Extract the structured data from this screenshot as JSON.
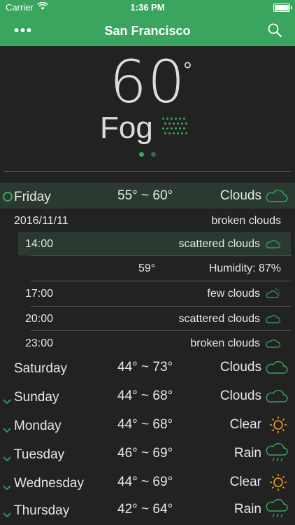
{
  "status": {
    "carrier": "Carrier",
    "time": "1:36 PM"
  },
  "nav": {
    "title": "San Francisco"
  },
  "current": {
    "temp": "60",
    "degree": "°",
    "condition": "Fog"
  },
  "today": {
    "day": "Friday",
    "range": "55° ~ 60°",
    "condition": "Clouds",
    "date": "2016/11/11",
    "summary": "broken clouds",
    "hours": [
      {
        "time": "14:00",
        "condition": "scattered clouds",
        "temp": "59°",
        "humidity": "Humidity: 87%"
      },
      {
        "time": "17:00",
        "condition": "few clouds"
      },
      {
        "time": "20:00",
        "condition": "scattered clouds"
      },
      {
        "time": "23:00",
        "condition": "broken clouds"
      }
    ]
  },
  "days": [
    {
      "day": "Saturday",
      "range": "44° ~ 73°",
      "condition": "Clouds",
      "icon": "cloud-icon"
    },
    {
      "day": "Sunday",
      "range": "44° ~ 68°",
      "condition": "Clouds",
      "icon": "cloud-icon"
    },
    {
      "day": "Monday",
      "range": "44° ~ 68°",
      "condition": "Clear",
      "icon": "sun-icon"
    },
    {
      "day": "Tuesday",
      "range": "46° ~ 69°",
      "condition": "Rain",
      "icon": "rain-icon"
    },
    {
      "day": "Wednesday",
      "range": "44° ~ 69°",
      "condition": "Clear",
      "icon": "sun-icon"
    },
    {
      "day": "Thursday",
      "range": "42° ~ 64°",
      "condition": "Rain",
      "icon": "rain-icon"
    }
  ],
  "colors": {
    "accent": "#3aa55f",
    "sun": "#e8a21f",
    "background": "#222222"
  }
}
